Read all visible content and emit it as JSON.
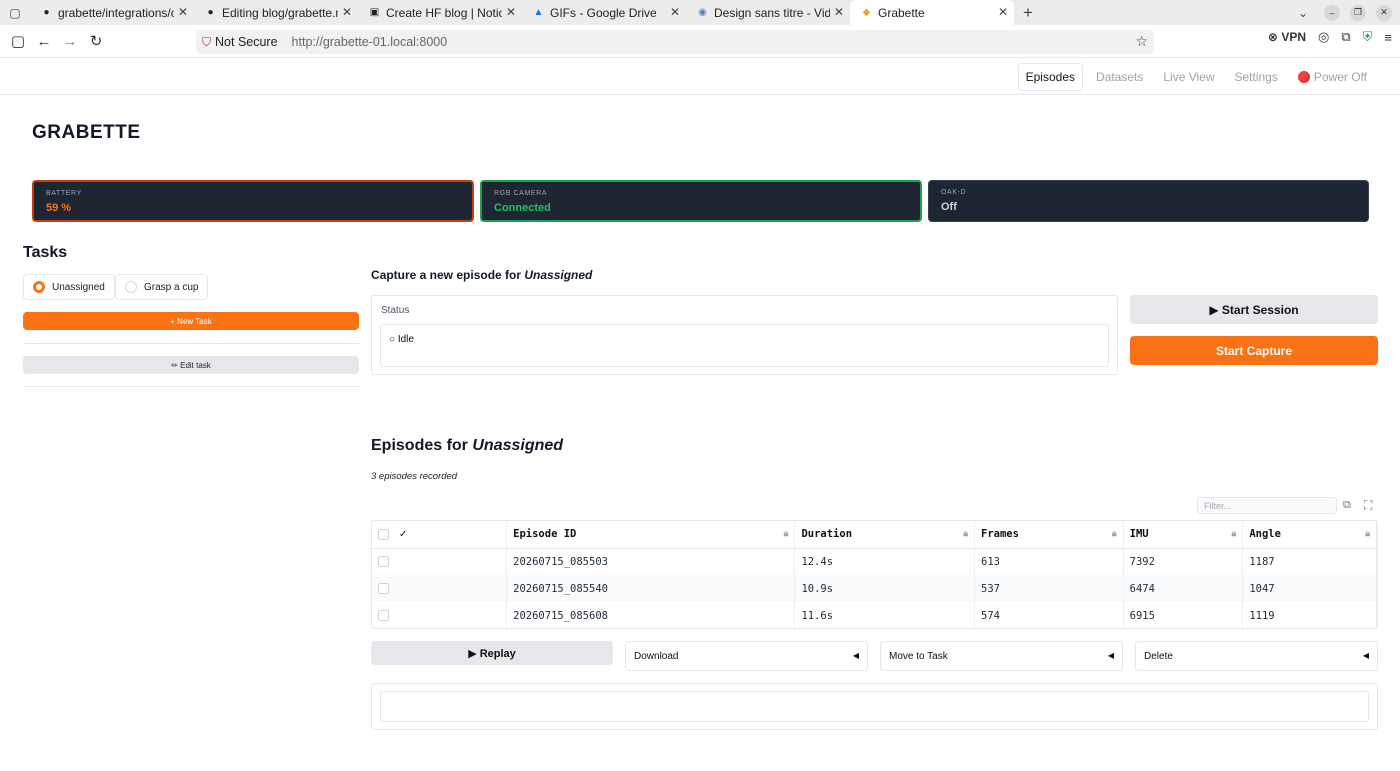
{
  "browser": {
    "tabs": [
      {
        "label": "grabette/integrations/op",
        "icon": "github-icon"
      },
      {
        "label": "Editing blog/grabette.m",
        "icon": "github-icon"
      },
      {
        "label": "Create HF blog | Notion",
        "icon": "notion-icon"
      },
      {
        "label": "GIFs - Google Drive",
        "icon": "drive-icon"
      },
      {
        "label": "Design sans titre - Vidéo",
        "icon": "globe-icon"
      },
      {
        "label": "Grabette",
        "icon": "hf-icon"
      }
    ],
    "security_label": "Not Secure",
    "url": "http://grabette-01.local:8000",
    "vpn_label": "VPN"
  },
  "nav": {
    "items": [
      "Episodes",
      "Datasets",
      "Live View",
      "Settings"
    ],
    "active": "Episodes",
    "power_label": "Power Off"
  },
  "brand": "GRABETTE",
  "status_cards": [
    {
      "label": "BATTERY",
      "value": "59 %",
      "color": "#f97316"
    },
    {
      "label": "RGB CAMERA",
      "value": "Connected",
      "color": "#22c55e"
    },
    {
      "label": "OAK-D",
      "value": "Off",
      "color": "#d1d5db"
    }
  ],
  "tasks": {
    "title": "Tasks",
    "options": [
      "Unassigned",
      "Grasp a cup"
    ],
    "selected": "Unassigned",
    "new_task_label": "+ New Task",
    "edit_task_label": "✏ Edit task"
  },
  "capture": {
    "title_prefix": "Capture a new episode for ",
    "task_name": "Unassigned",
    "status_label": "Status",
    "status_value": "○ Idle",
    "start_session_label": "▶ Start Session",
    "start_capture_label": "Start Capture"
  },
  "episodes": {
    "title_prefix": "Episodes for ",
    "task_name": "Unassigned",
    "count_text": "3 episodes recorded",
    "filter_placeholder": "Filter...",
    "columns": [
      "Episode ID",
      "Duration",
      "Frames",
      "IMU",
      "Angle"
    ],
    "check_header": "✓",
    "rows": [
      [
        "20260715_085503",
        "12.4s",
        "613",
        "7392",
        "1187"
      ],
      [
        "20260715_085540",
        "10.9s",
        "537",
        "6474",
        "1047"
      ],
      [
        "20260715_085608",
        "11.6s",
        "574",
        "6915",
        "1119"
      ]
    ],
    "replay_label": "▶ Replay",
    "download_label": "Download",
    "move_label": "Move to Task",
    "delete_label": "Delete"
  }
}
